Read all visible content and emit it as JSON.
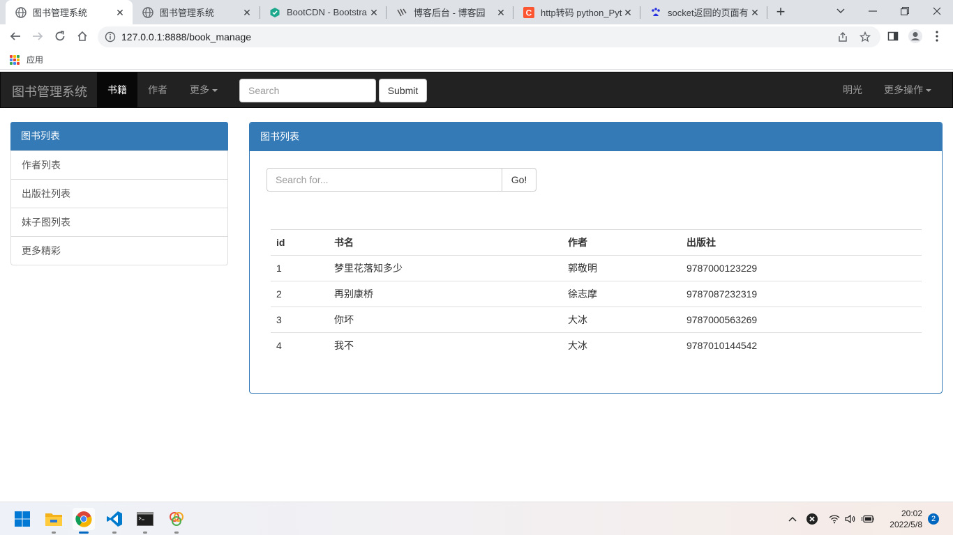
{
  "browser": {
    "tabs": [
      {
        "title": "图书管理系统",
        "favicon": "globe-icon",
        "active": true
      },
      {
        "title": "图书管理系统",
        "favicon": "globe-icon",
        "active": false
      },
      {
        "title": "BootCDN - Bootstra",
        "favicon": "bootcdn-icon",
        "active": false
      },
      {
        "title": "博客后台 - 博客园",
        "favicon": "cnblogs-icon",
        "active": false
      },
      {
        "title": "http转码 python_Pyt",
        "favicon": "csdn-icon",
        "active": false
      },
      {
        "title": "socket返回的页面有…",
        "favicon": "baidu-icon",
        "active": false
      }
    ],
    "url": "127.0.0.1:8888/book_manage",
    "bookmarks": {
      "apps_label": "应用"
    }
  },
  "navbar": {
    "brand": "图书管理系统",
    "items": [
      {
        "label": "书籍",
        "active": true
      },
      {
        "label": "作者",
        "active": false
      },
      {
        "label": "更多",
        "active": false,
        "dropdown": true
      }
    ],
    "search_placeholder": "Search",
    "submit_label": "Submit",
    "right_items": [
      {
        "label": "明光"
      },
      {
        "label": "更多操作",
        "dropdown": true
      }
    ]
  },
  "sidebar": {
    "heading": "图书列表",
    "items": [
      {
        "label": "作者列表"
      },
      {
        "label": "出版社列表"
      },
      {
        "label": "妹子图列表"
      },
      {
        "label": "更多精彩"
      }
    ]
  },
  "main": {
    "heading": "图书列表",
    "search_placeholder": "Search for...",
    "go_label": "Go!",
    "table": {
      "headers": [
        "id",
        "书名",
        "作者",
        "出版社"
      ],
      "rows": [
        [
          "1",
          "梦里花落知多少",
          "郭敬明",
          "9787000123229"
        ],
        [
          "2",
          "再别康桥",
          "徐志摩",
          "9787087232319"
        ],
        [
          "3",
          "你坏",
          "大冰",
          "9787000563269"
        ],
        [
          "4",
          "我不",
          "大冰",
          "9787010144542"
        ]
      ]
    }
  },
  "taskbar": {
    "icons": [
      "windows-start-icon",
      "file-explorer-icon",
      "chrome-icon",
      "vscode-icon",
      "terminal-icon",
      "app-icon"
    ],
    "time": "20:02",
    "date": "2022/5/8",
    "notifications": "2"
  },
  "colors": {
    "primary": "#337ab7",
    "navbar_bg": "#222222",
    "navbar_active": "#080808"
  }
}
